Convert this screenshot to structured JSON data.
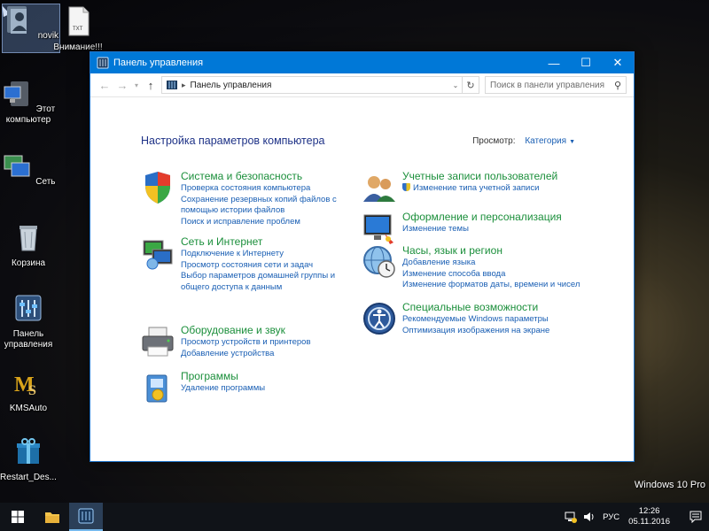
{
  "desktop": {
    "icons": [
      {
        "label": "novik"
      },
      {
        "label": "Внимание!!!"
      },
      {
        "label": "Этот компьютер"
      },
      {
        "label": "Сеть"
      },
      {
        "label": "Корзина"
      },
      {
        "label": "Панель управления"
      },
      {
        "label": "KMSAuto"
      },
      {
        "label": "Restart_Des..."
      }
    ],
    "watermark": "Windows 10 Pro"
  },
  "window": {
    "title": "Панель управления",
    "buttons": {
      "minimize": "—",
      "maximize": "☐",
      "close": "✕"
    },
    "address": {
      "breadcrumb": "Панель управления",
      "search_placeholder": "Поиск в панели управления"
    },
    "heading": "Настройка параметров компьютера",
    "view_by": {
      "label": "Просмотр:",
      "value": "Категория"
    },
    "categories_left": [
      {
        "title": "Система и безопасность",
        "links": [
          "Проверка состояния компьютера",
          "Сохранение резервных копий файлов с помощью истории файлов",
          "Поиск и исправление проблем"
        ]
      },
      {
        "title": "Сеть и Интернет",
        "links": [
          "Подключение к Интернету",
          "Просмотр состояния сети и задач",
          "Выбор параметров домашней группы и общего доступа к данным"
        ]
      },
      {
        "title": "Оборудование и звук",
        "links": [
          "Просмотр устройств и принтеров",
          "Добавление устройства"
        ]
      },
      {
        "title": "Программы",
        "links": [
          "Удаление программы"
        ]
      }
    ],
    "categories_right": [
      {
        "title": "Учетные записи пользователей",
        "links": [
          "Изменение типа учетной записи"
        ]
      },
      {
        "title": "Оформление и персонализация",
        "links": [
          "Изменение темы"
        ]
      },
      {
        "title": "Часы, язык и регион",
        "links": [
          "Добавление языка",
          "Изменение способа ввода",
          "Изменение форматов даты, времени и чисел"
        ]
      },
      {
        "title": "Специальные возможности",
        "links": [
          "Рекомендуемые Windows параметры",
          "Оптимизация изображения на экране"
        ]
      }
    ]
  },
  "taskbar": {
    "language": "РУС",
    "time": "12:26",
    "date": "05.11.2016"
  },
  "colors": {
    "accent": "#0078d7",
    "category_title": "#1b8f3b",
    "link": "#1a5fb4"
  }
}
